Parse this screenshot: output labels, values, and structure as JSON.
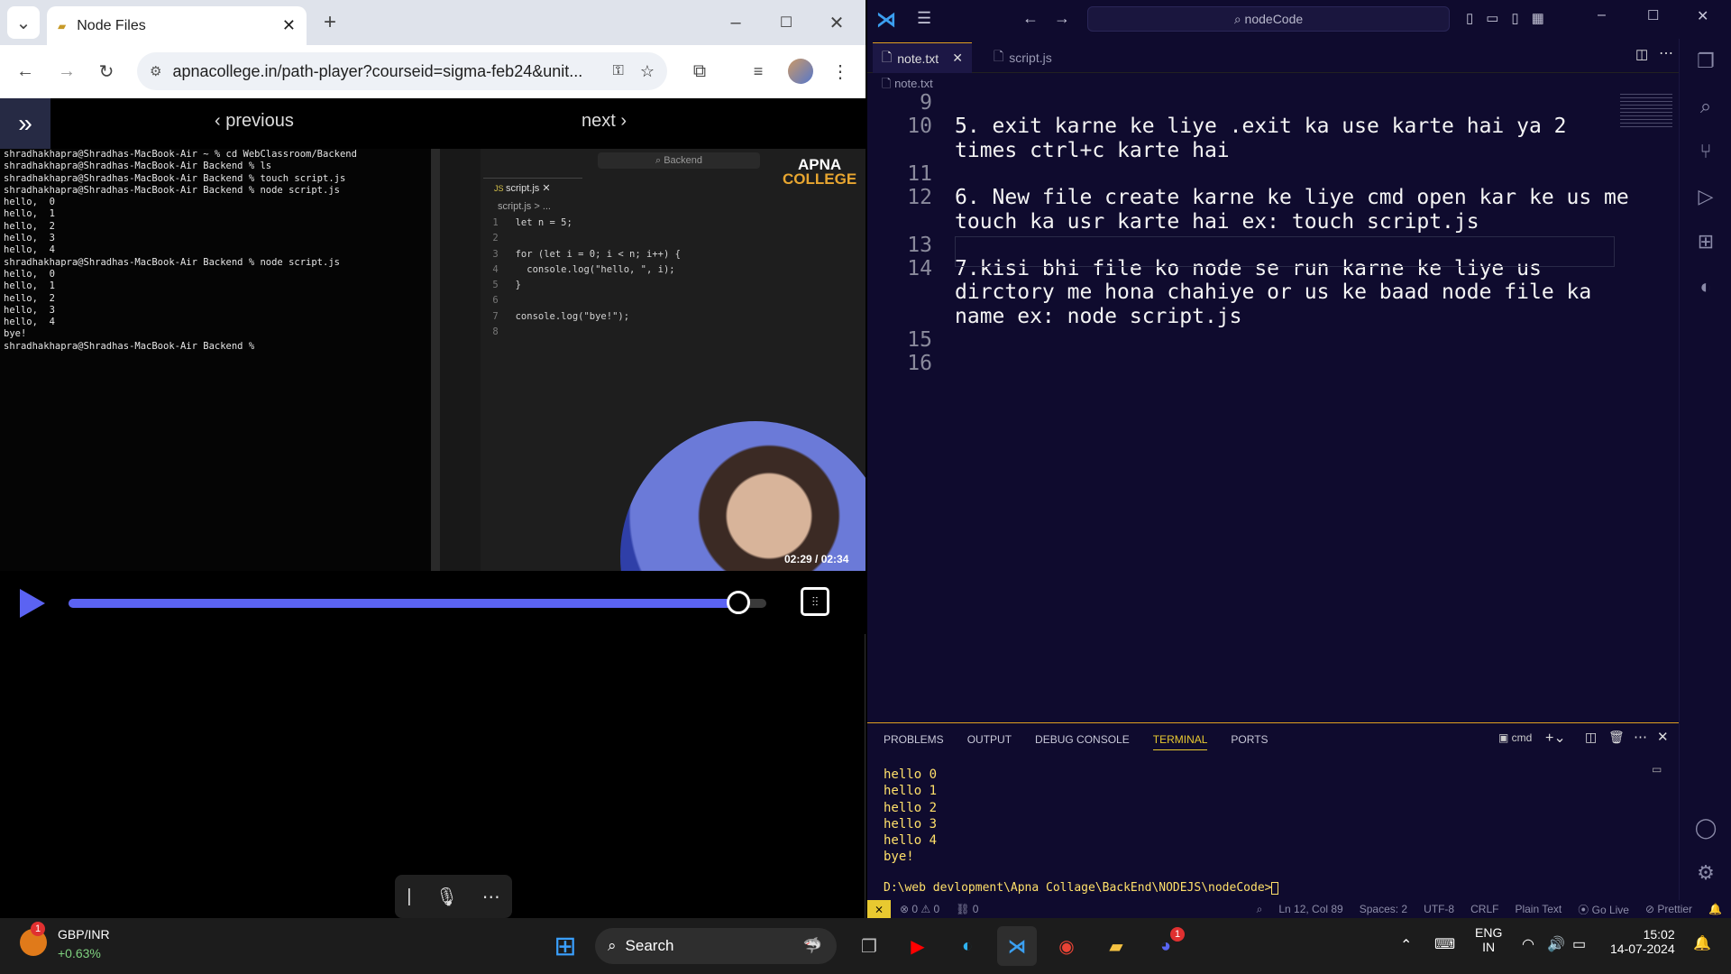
{
  "chrome": {
    "tab_title": "Node Files",
    "url": "apnacollege.in/path-player?courseid=sigma-feb24&unit...",
    "player": {
      "previous": "previous",
      "next": "next"
    },
    "video_time": "02:29 / 02:34",
    "progress": 0.96,
    "watermark": "APNA COLLEGE",
    "mac_term_lines": [
      "shradhakhapra@Shradhas-MacBook-Air ~ % cd WebClassroom/Backend",
      "shradhakhapra@Shradhas-MacBook-Air Backend % ls",
      "shradhakhapra@Shradhas-MacBook-Air Backend % touch script.js",
      "shradhakhapra@Shradhas-MacBook-Air Backend % node script.js",
      "hello,  0",
      "hello,  1",
      "hello,  2",
      "hello,  3",
      "hello,  4",
      "shradhakhapra@Shradhas-MacBook-Air Backend % node script.js",
      "hello,  0",
      "hello,  1",
      "hello,  2",
      "hello,  3",
      "hello,  4",
      "bye!",
      "shradhakhapra@Shradhas-MacBook-Air Backend % "
    ],
    "mac_vscode": {
      "search": "Backend",
      "tab": "script.js",
      "breadcrumb": "script.js > ...",
      "lines": [
        "let n = 5;",
        "",
        "for (let i = 0; i < n; i++) {",
        "  console.log(\"hello, \", i);",
        "}",
        "",
        "console.log(\"bye!\");",
        ""
      ]
    }
  },
  "vscode": {
    "search": "nodeCode",
    "tabs": [
      "note.txt",
      "script.js"
    ],
    "breadcrumb": "note.txt",
    "editor_lines": [
      {
        "n": "9",
        "t": ""
      },
      {
        "n": "10",
        "t": "5. exit karne ke liye .exit ka use karte hai ya 2"
      },
      {
        "n": "",
        "t": "times ctrl+c karte hai"
      },
      {
        "n": "11",
        "t": ""
      },
      {
        "n": "12",
        "t": "6. New file create karne ke liye cmd open kar ke us me"
      },
      {
        "n": "",
        "t": "touch ka usr karte hai ex: touch script.js"
      },
      {
        "n": "13",
        "t": ""
      },
      {
        "n": "14",
        "t": "7.kisi bhi file ko node se run karne ke liye us"
      },
      {
        "n": "",
        "t": "dirctory me hona chahiye or us ke baad node file ka"
      },
      {
        "n": "",
        "t": "name ex: node script.js"
      },
      {
        "n": "15",
        "t": ""
      },
      {
        "n": "16",
        "t": ""
      }
    ],
    "panel_tabs": [
      "PROBLEMS",
      "OUTPUT",
      "DEBUG CONSOLE",
      "TERMINAL",
      "PORTS"
    ],
    "terminal_profile": "cmd",
    "terminal_lines": [
      "hello 0",
      "hello 1",
      "hello 2",
      "hello 3",
      "hello 4",
      "bye!"
    ],
    "prompt": "D:\\web devlopment\\Apna Collage\\BackEnd\\NODEJS\\nodeCode>",
    "status": {
      "errors": "0",
      "warnings": "0",
      "ports": "0",
      "position": "Ln 12, Col 89",
      "spaces": "Spaces: 2",
      "encoding": "UTF-8",
      "eol": "CRLF",
      "language": "Plain Text",
      "golive": "Go Live",
      "prettier": "Prettier"
    }
  },
  "taskbar": {
    "ticker": "GBP/INR",
    "ticker_change": "+0.63%",
    "ticker_badge": "1",
    "search": "Search",
    "lang1": "ENG",
    "lang2": "IN",
    "time": "15:02",
    "date": "14-07-2024",
    "discord_badge": "1"
  }
}
